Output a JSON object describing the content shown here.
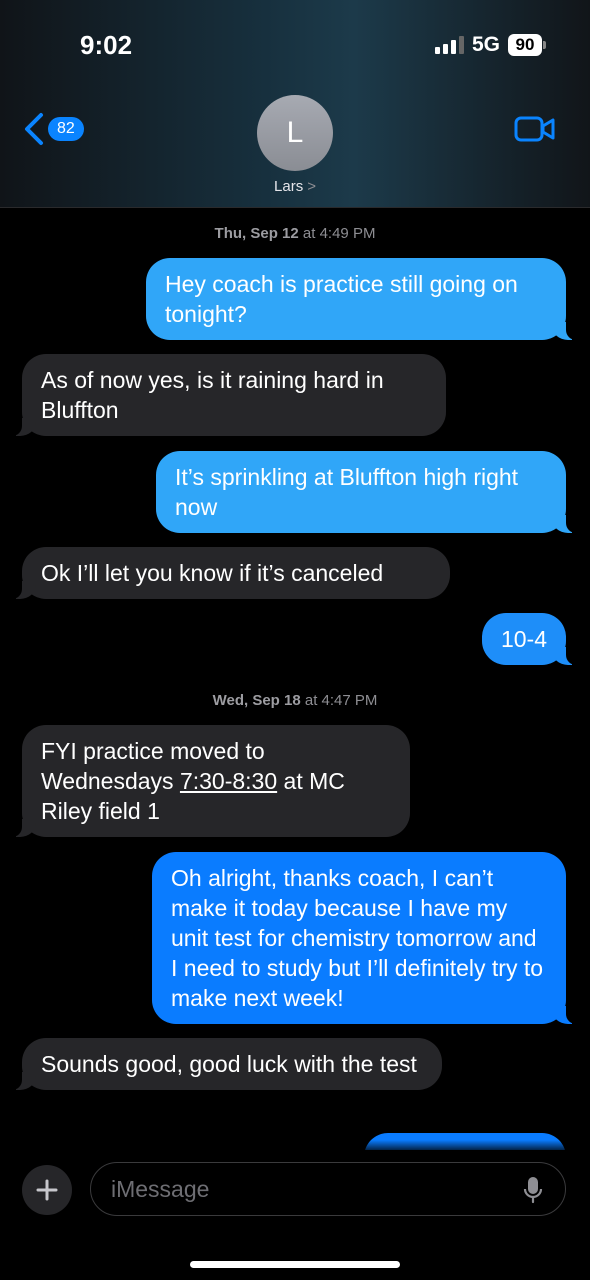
{
  "status_bar": {
    "time": "9:02",
    "network": "5G",
    "battery": "90",
    "signal_bars_active": 3
  },
  "header": {
    "back_count": "82",
    "avatar_initial": "L",
    "contact_name": "Lars",
    "chevron": ">",
    "video_icon": "video-camera-icon"
  },
  "conversation": {
    "timestamp_1": {
      "day": "Thu, Sep 12",
      "time": "at 4:49 PM"
    },
    "msg1": "Hey coach is practice still going on tonight?",
    "msg2": "As of now yes, is it raining hard in Bluffton",
    "msg3": "It’s sprinkling at Bluffton high right now",
    "msg4": "Ok I’ll let you know if it’s canceled",
    "msg5": "10-4",
    "timestamp_2": {
      "day": "Wed, Sep 18",
      "time": "at 4:47 PM"
    },
    "msg6": {
      "before": "FYI practice moved to Wednesdays ",
      "link": "7:30-8:30",
      "after": " at MC Riley field 1"
    },
    "msg7": "Oh alright, thanks coach, I can’t make it today because I have my unit test for chemistry tomorrow and I need to study but I’ll definitely try to make next week!",
    "msg8": "Sounds good, good luck with the test"
  },
  "composer": {
    "placeholder": "iMessage",
    "value": ""
  },
  "colors": {
    "incoming_bubble": "#262629",
    "outgoing_bubble": "#0a7cff",
    "accent": "#0a84ff"
  }
}
